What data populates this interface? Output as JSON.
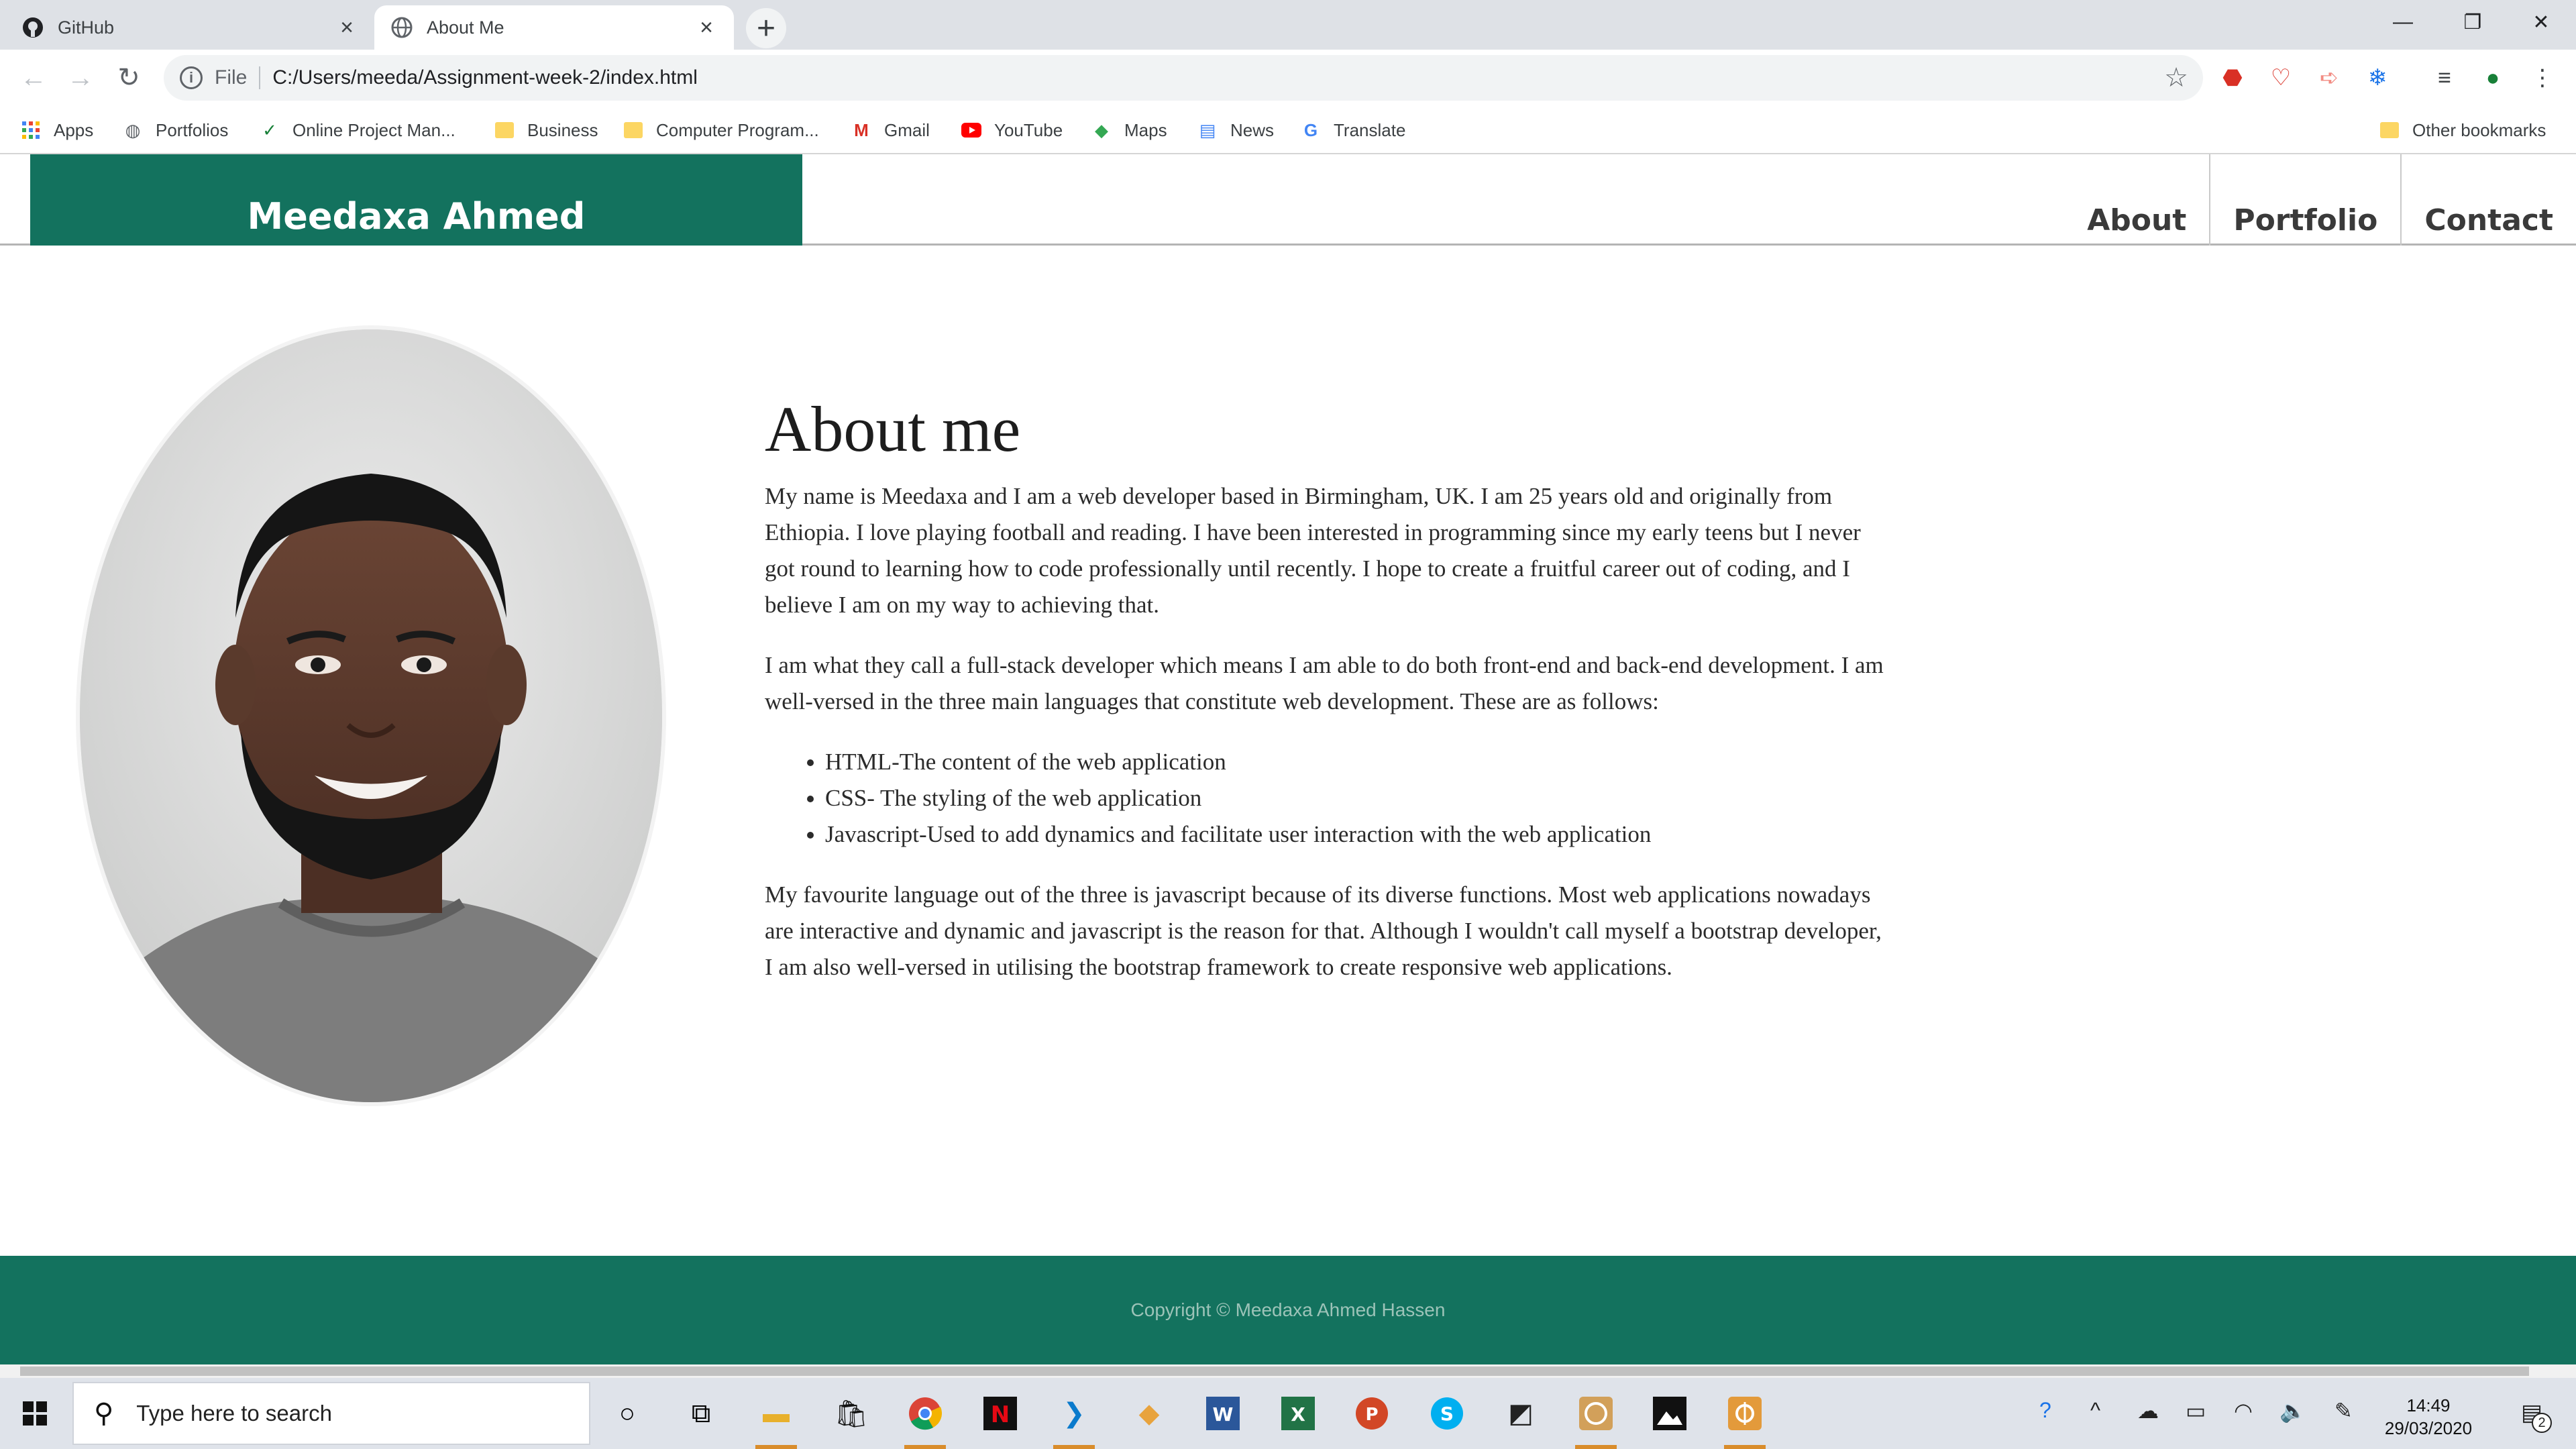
{
  "browser": {
    "tabs": [
      {
        "title": "GitHub",
        "icon": "github-icon"
      },
      {
        "title": "About Me",
        "icon": "globe-icon"
      }
    ],
    "new_tab": "+",
    "window_controls": {
      "minimize": "—",
      "restore": "❐",
      "close": "✕"
    },
    "address": {
      "scheme": "File",
      "url": "C:/Users/meeda/Assignment-week-2/index.html"
    },
    "bookmarks": [
      {
        "label": "Apps",
        "icon": "apps-grid-icon"
      },
      {
        "label": "Portfolios",
        "icon": "globe-icon"
      },
      {
        "label": "Online Project Man...",
        "icon": "checkmark-icon"
      },
      {
        "label": "Business",
        "icon": "folder-icon"
      },
      {
        "label": "Computer Program...",
        "icon": "folder-icon"
      },
      {
        "label": "Gmail",
        "icon": "gmail-icon"
      },
      {
        "label": "YouTube",
        "icon": "youtube-icon"
      },
      {
        "label": "Maps",
        "icon": "maps-icon"
      },
      {
        "label": "News",
        "icon": "news-icon"
      },
      {
        "label": "Translate",
        "icon": "translate-icon"
      }
    ],
    "other_bookmarks": "Other bookmarks"
  },
  "site": {
    "brand": "Meedaxa Ahmed",
    "nav": [
      "About",
      "Portfolio",
      "Contact"
    ],
    "colors": {
      "primary": "#13725e",
      "footer_text": "#9cc3b8"
    },
    "about": {
      "heading": "About me",
      "p1": "My name is Meedaxa and I am a web developer based in Birmingham, UK. I am 25 years old and originally from Ethiopia. I love playing football and reading. I have been interested in programming since my early teens but I never got round to learning how to code professionally until recently. I hope to create a fruitful career out of coding, and I believe I am on my way to achieving that.",
      "p2": "I am what they call a full-stack developer which means I am able to do both front-end and back-end development. I am well-versed in the three main languages that constitute web development. These are as follows:",
      "languages": [
        "HTML-The content of the web application",
        "CSS- The styling of the web application",
        "Javascript-Used to add dynamics and facilitate user interaction with the web application"
      ],
      "p3": "My favourite language out of the three is javascript because of its diverse functions. Most web applications nowadays are interactive and dynamic and javascript is the reason for that. Although I wouldn't call myself a bootstrap developer, I am also well-versed in utilising the bootstrap framework to create responsive web applications."
    },
    "footer": "Copyright © Meedaxa Ahmed Hassen"
  },
  "taskbar": {
    "search_placeholder": "Type here to search",
    "time": "14:49",
    "date": "29/03/2020",
    "notification_count": "2"
  }
}
